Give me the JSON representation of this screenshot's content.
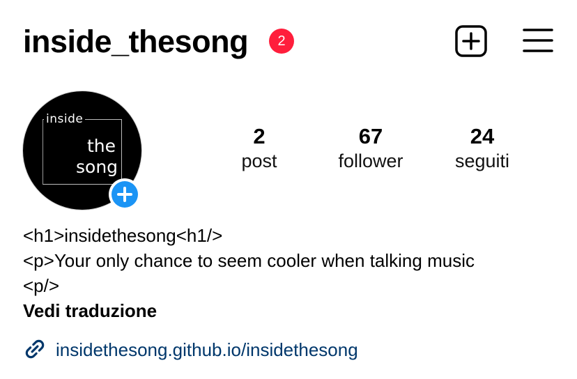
{
  "header": {
    "username": "inside_thesong",
    "notification_count": "2",
    "create_icon": "plus-square-icon",
    "menu_icon": "hamburger-menu-icon"
  },
  "profile": {
    "avatar_logo": {
      "line1": "inside",
      "line2": "the",
      "line3": "song"
    },
    "add_story_icon": "plus-icon",
    "accent_color": "#1b94f5"
  },
  "stats": [
    {
      "value": "2",
      "label": "post"
    },
    {
      "value": "67",
      "label": "follower"
    },
    {
      "value": "24",
      "label": "seguiti"
    }
  ],
  "bio": {
    "line1": "<h1>insidethesong<h1/>",
    "line2": "<p>Your only chance to seem cooler when talking music",
    "line3": "<p/>",
    "translate_label": "Vedi traduzione"
  },
  "link": {
    "icon": "link-icon",
    "url_text": "insidethesong.github.io/insidethesong",
    "color": "#00376b"
  }
}
